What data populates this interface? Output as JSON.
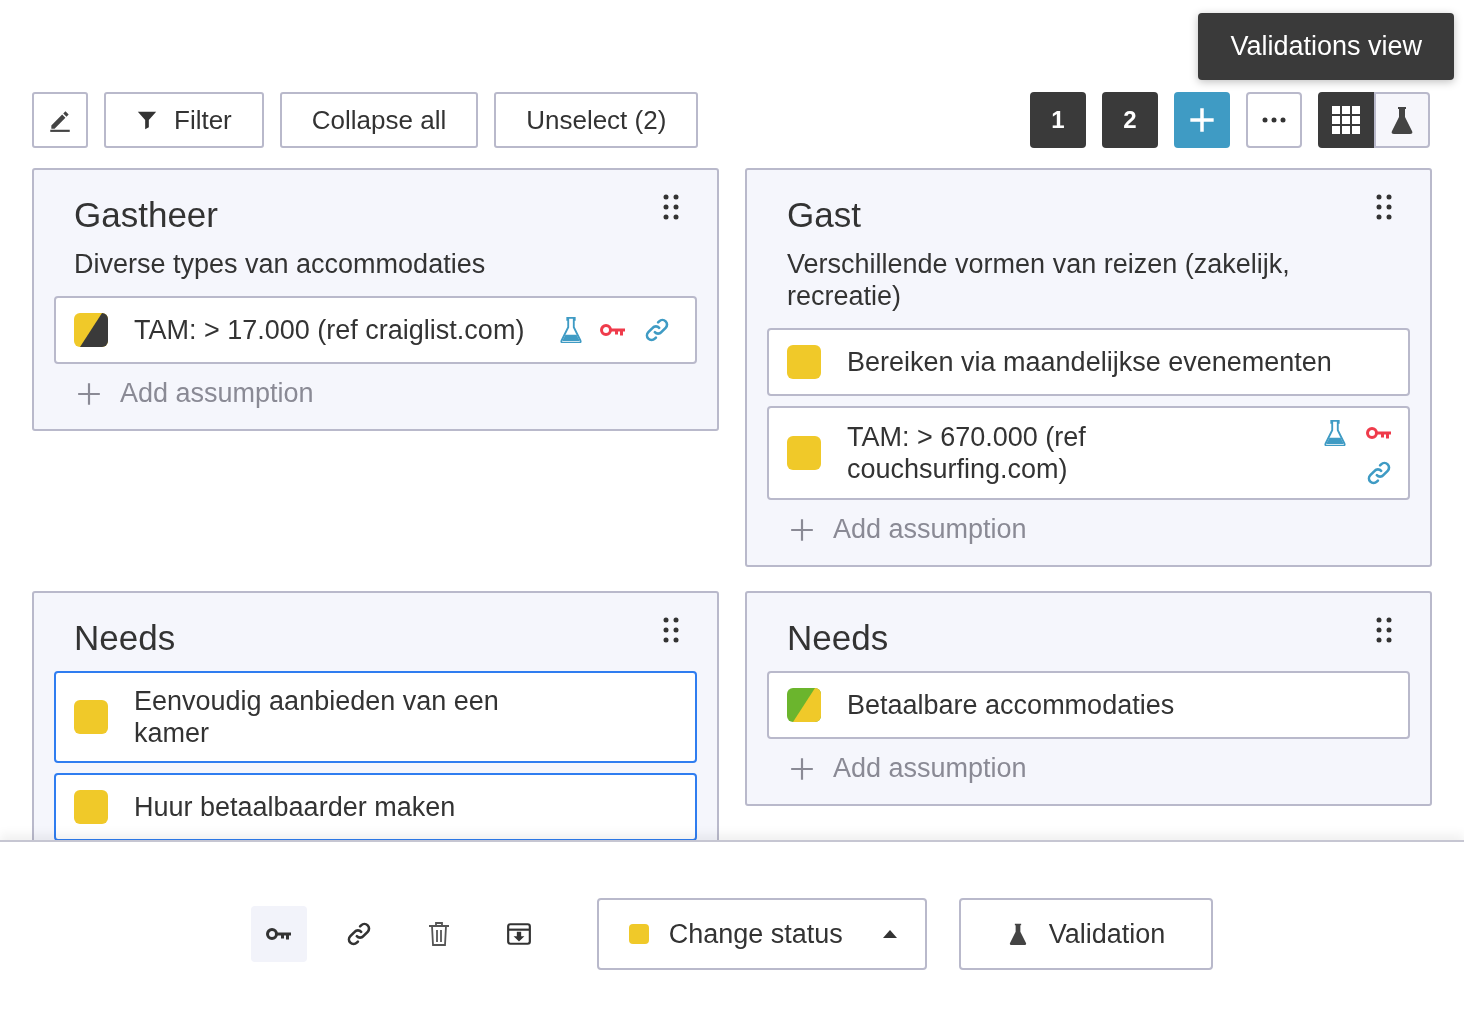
{
  "toolbar": {
    "buttons": [
      {
        "kind": "filter",
        "label": "Filter"
      },
      {
        "kind": "plain",
        "label": "Collapse all"
      },
      {
        "kind": "plain",
        "label": "Unselect (2)"
      }
    ],
    "pages": [
      {
        "label": "1"
      },
      {
        "label": "2"
      }
    ],
    "view_toggle": [
      {
        "kind": "grid",
        "selected": true
      },
      {
        "kind": "validation",
        "selected": false
      }
    ],
    "tooltip": "Validations view"
  },
  "sections": [
    {
      "title": "Gastheer",
      "subtitle": "Diverse types van accommodaties",
      "assumptions": [
        {
          "text": "TAM: > 17.000 (ref craiglist.com)",
          "status": [
            {
              "color": "#f0c929"
            },
            {
              "color": "#3a3a3a"
            }
          ],
          "validation": true,
          "linked": true,
          "key": true,
          "selected": false
        }
      ],
      "add_label": "Add assumption"
    },
    {
      "title": "Gast",
      "subtitle": "Verschillende vormen van reizen (zakelijk, recreatie)",
      "assumptions": [
        {
          "text": "Bereiken via maandelijkse evenementen",
          "status": [
            {
              "color": "#f0c929"
            }
          ],
          "validation": false,
          "linked": false,
          "key": false,
          "selected": false
        },
        {
          "text": "TAM: > 670.000 (ref couchsurfing.com)",
          "status": [
            {
              "color": "#f0c929"
            }
          ],
          "validation": true,
          "linked": true,
          "key": true,
          "selected": false,
          "stacked_icons": true
        }
      ],
      "add_label": "Add assumption"
    },
    {
      "title": "Needs",
      "assumptions": [
        {
          "text": "Eenvoudig aanbieden van een kamer",
          "status": [
            {
              "color": "#f0c929"
            }
          ],
          "validation": false,
          "linked": false,
          "key": false,
          "selected": true
        },
        {
          "text": "Huur betaalbaarder maken",
          "status": [
            {
              "color": "#f0c929"
            }
          ],
          "validation": false,
          "linked": false,
          "key": false,
          "selected": true
        }
      ]
    },
    {
      "title": "Needs",
      "assumptions": [
        {
          "text": "Betaalbare accommodaties",
          "status": [
            {
              "color": "#6bb52d"
            },
            {
              "color": "#f0c929"
            }
          ],
          "validation": false,
          "linked": false,
          "key": false,
          "selected": false
        }
      ],
      "add_label": "Add assumption"
    }
  ],
  "action_bar": {
    "actions": [
      {
        "kind": "key",
        "hovered": true
      },
      {
        "kind": "link",
        "hovered": false
      },
      {
        "kind": "trash",
        "hovered": false
      },
      {
        "kind": "archive",
        "hovered": false
      }
    ],
    "status_dropdown": {
      "label": "Change status",
      "color": "#f0c929"
    },
    "validation_button": {
      "label": "Validation"
    }
  }
}
